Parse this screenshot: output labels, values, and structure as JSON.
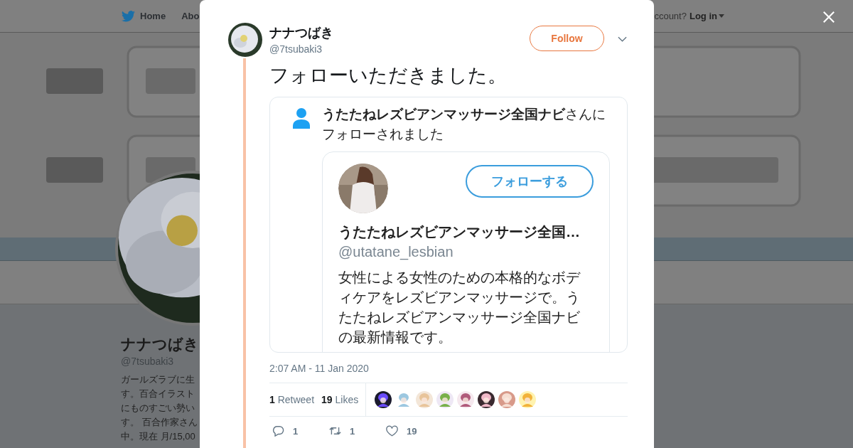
{
  "nav": {
    "home": "Home",
    "about": "Abo",
    "login_prompt": "ccount?",
    "login": "Log in"
  },
  "profile": {
    "name": "ナナつばき",
    "handle": "@7tsubaki3",
    "bio_lines": [
      "ガールズラブに生",
      "す。百合イラスト",
      "にものすごい勢い",
      "す。 百合作家さん",
      "中。現在 月/15,00"
    ]
  },
  "tweet": {
    "author": {
      "name": "ナナつばき",
      "handle": "@7tsubaki3"
    },
    "follow_label": "Follow",
    "text": "フォローいただきました。",
    "attachment": {
      "notice": "**うたたねレズビアンマッサージ全国ナビ**さんにフォローされました",
      "follow_label": "フォローする",
      "name": "うたたねレズビアンマッサージ全国…",
      "handle": "@utatane_lesbian",
      "bio": "女性による女性のための本格的なボディケアをレズビアンマッサージで。うたたねレズビアンマッサージ全国ナビの最新情報です。"
    },
    "timestamp": "2:07 AM - 11 Jan 2020",
    "retweets": "**1** Retweet",
    "likes": "**19** Likes",
    "actions": [
      {
        "kind": "reply",
        "count": "1"
      },
      {
        "kind": "retweet",
        "count": "1"
      },
      {
        "kind": "like",
        "count": "19"
      }
    ]
  }
}
